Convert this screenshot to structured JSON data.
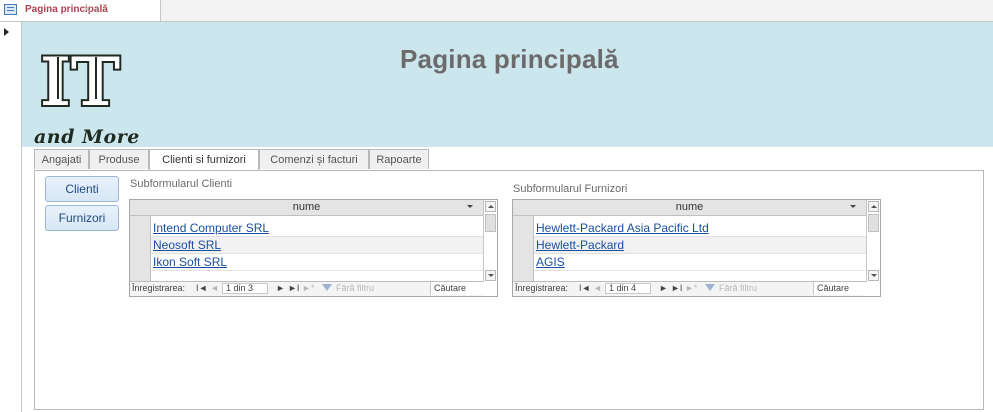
{
  "document_tab": {
    "title": "Pagina principală",
    "close_glyph": "✕",
    "icon": "form-icon"
  },
  "header": {
    "logo_text": "IT",
    "logo_caption": "and More",
    "title": "Pagina principală",
    "background_color": "#cce6ed"
  },
  "tabs": [
    {
      "label": "Angajati"
    },
    {
      "label": "Produse"
    },
    {
      "label": "Clienti si furnizori",
      "active": true
    },
    {
      "label": "Comenzi și facturi"
    },
    {
      "label": "Rapoarte"
    }
  ],
  "side_buttons": {
    "clienti": "Clienti",
    "furnizori": "Furnizori"
  },
  "subform_clienti": {
    "label": "Subformularul Clienti",
    "column": "nume",
    "rows": [
      "Intend Computer SRL",
      "Neosoft SRL",
      "Ikon Soft SRL"
    ],
    "nav": {
      "record_label": "Înregistrarea:",
      "first": "I◄",
      "prev": "◄",
      "position": "1 din 3",
      "next": "►",
      "last": "►I",
      "new": "►*",
      "filter": "Fără filtru",
      "search": "Căutare"
    }
  },
  "subform_furnizori": {
    "label": "Subformularul Furnizori",
    "column": "nume",
    "rows": [
      "Hewlett-Packard Asia Pacific Ltd",
      "Hewlett-Packard",
      "AGIS"
    ],
    "nav": {
      "record_label": "Înregistrarea:",
      "first": "I◄",
      "prev": "◄",
      "position": "1 din 4",
      "next": "►",
      "last": "►I",
      "new": "►*",
      "filter": "Fără filtru",
      "search": "Căutare"
    }
  }
}
